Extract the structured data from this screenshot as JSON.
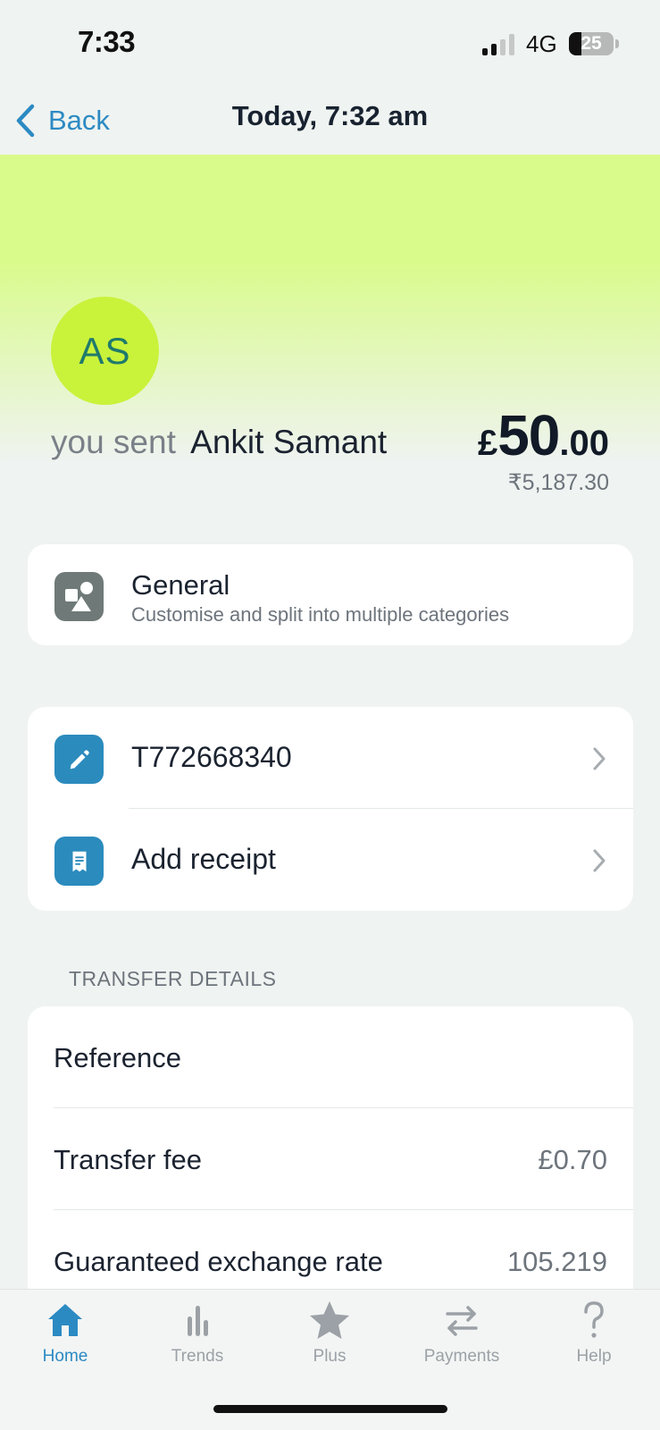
{
  "status_bar": {
    "time": "7:33",
    "network": "4G",
    "battery": "25"
  },
  "nav": {
    "back_label": "Back",
    "title": "Today, 7:32 am"
  },
  "transaction": {
    "avatar_initials": "AS",
    "sent_prefix": "you sent",
    "recipient": "Ankit Samant",
    "amount_currency": "£",
    "amount_major": "50",
    "amount_minor": ".00",
    "converted_amount": "₹5,187.30"
  },
  "category": {
    "title": "General",
    "subtitle": "Customise and split into multiple categories",
    "icon": "shapes-icon"
  },
  "actions": [
    {
      "label": "T772668340",
      "icon": "pencil-icon"
    },
    {
      "label": "Add receipt",
      "icon": "receipt-icon"
    }
  ],
  "transfer_details": {
    "header": "TRANSFER DETAILS",
    "rows": [
      {
        "label": "Reference",
        "value": ""
      },
      {
        "label": "Transfer fee",
        "value": "£0.70"
      },
      {
        "label": "Guaranteed exchange rate",
        "value": "105.219"
      }
    ]
  },
  "tabs": [
    {
      "label": "Home",
      "icon": "home-icon",
      "active": true
    },
    {
      "label": "Trends",
      "icon": "bar-chart-icon",
      "active": false
    },
    {
      "label": "Plus",
      "icon": "star-icon",
      "active": false
    },
    {
      "label": "Payments",
      "icon": "transfer-arrows-icon",
      "active": false
    },
    {
      "label": "Help",
      "icon": "question-icon",
      "active": false
    }
  ],
  "colors": {
    "accent": "#2c8ac3",
    "hero_lime": "#d9fb8b",
    "avatar": "#c9f23a",
    "background": "#eff3f1"
  }
}
